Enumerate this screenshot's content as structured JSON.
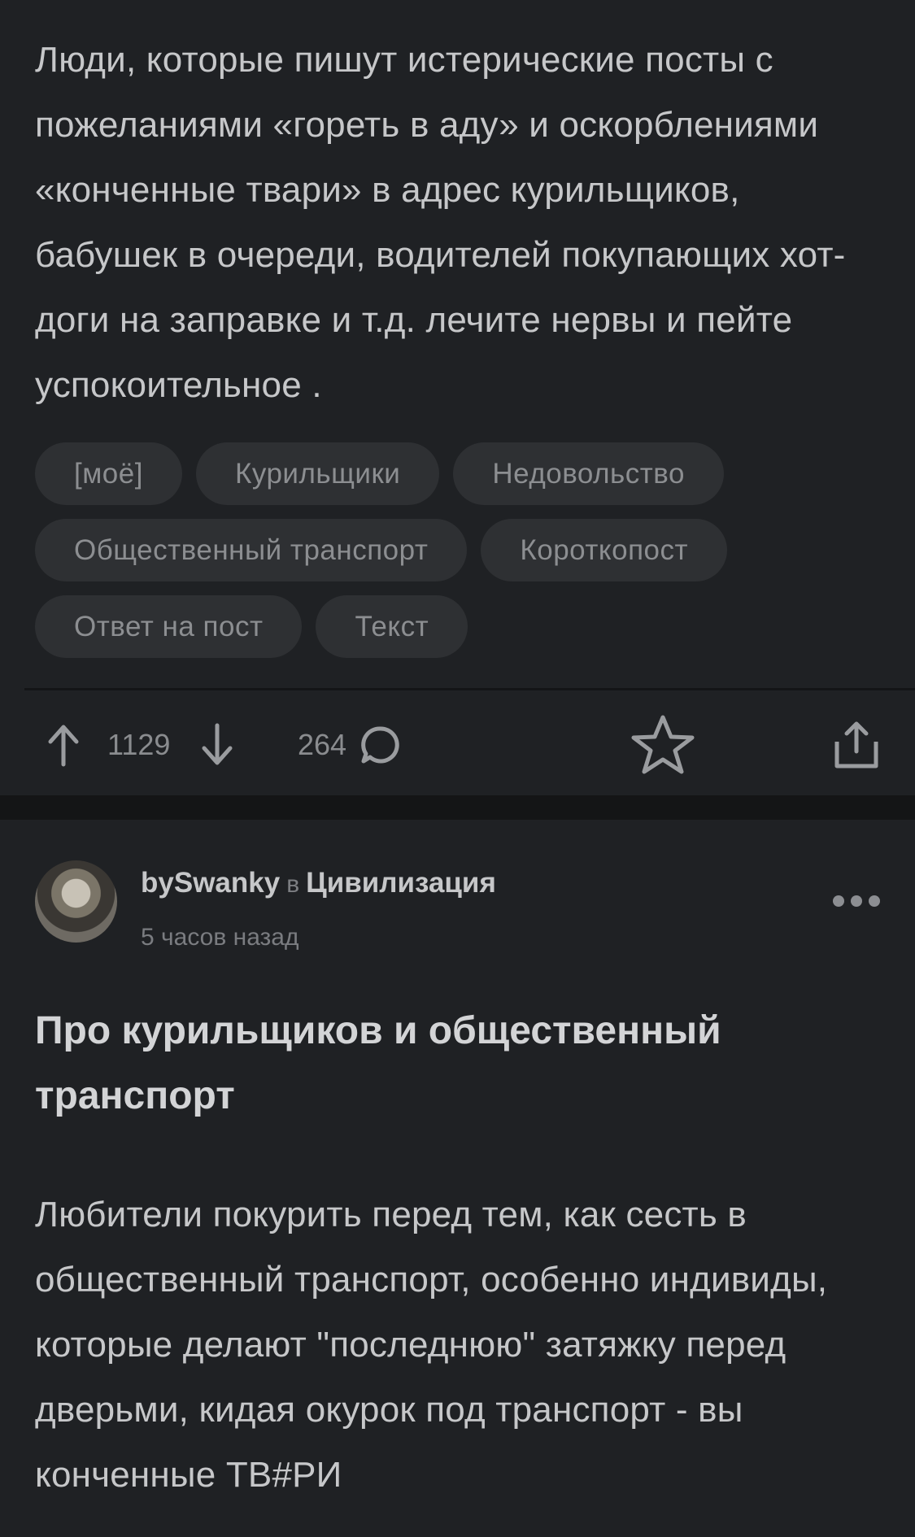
{
  "post1": {
    "body": "Люди, которые пишут истерические посты с пожеланиями «гореть в аду» и оскорблениями «конченные твари» в адрес курильщиков, бабушек в очереди, водителей покупающих хот-доги на заправке и т.д. лечите нервы и пейте успокоительное .",
    "tags": [
      "[моё]",
      "Курильщики",
      "Недовольство",
      "Общественный транспорт",
      "Короткопост",
      "Ответ на пост",
      "Текст"
    ],
    "rating": "1129",
    "comments": "264"
  },
  "post2": {
    "author": "bySwanky",
    "in_label": "в",
    "community": "Цивилизация",
    "time": "5 часов назад",
    "title": "Про курильщиков и общественный транспорт",
    "body": "Любители покурить перед тем, как сесть в общественный транспорт, особенно индивиды, которые делают \"последнюю\" затяжку перед дверьми, кидая окурок под транспорт - вы конченные ТВ#РИ"
  },
  "icons": [
    "arrow-up-icon",
    "arrow-down-icon",
    "comment-icon",
    "star-icon",
    "share-icon",
    "more-icon"
  ]
}
